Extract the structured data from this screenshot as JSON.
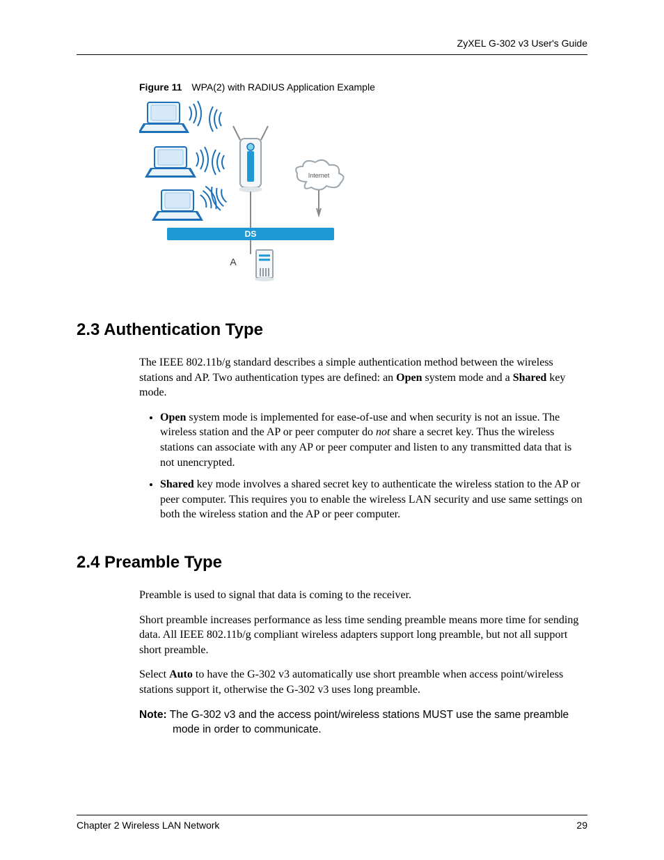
{
  "running_head": "ZyXEL G-302 v3 User's Guide",
  "figure": {
    "label": "Figure 11",
    "title": "WPA(2) with RADIUS Application Example",
    "labels": {
      "internet": "Internet",
      "ds": "DS",
      "a": "A"
    }
  },
  "section_23": {
    "heading": "2.3  Authentication Type",
    "intro_parts": {
      "p1": "The IEEE 802.11b/g standard describes a simple authentication method between the wireless stations and AP. Two authentication types are defined: an ",
      "open_bold": "Open",
      "p2": " system mode and a ",
      "shared_bold": "Shared",
      "p3": " key mode."
    },
    "bullet_open": {
      "bold": "Open",
      "t1": " system mode is implemented for ease-of-use and when security is not an issue. The wireless station and the AP or peer computer do ",
      "not_italic": "not",
      "t2": " share a secret key. Thus the wireless stations can associate with any AP or peer computer and listen to any transmitted data that is not unencrypted."
    },
    "bullet_shared": {
      "bold": "Shared",
      "t1": " key mode involves a shared secret key to authenticate the wireless station to the AP or peer computer. This requires you to enable the wireless LAN security and use same settings on both the wireless station and the AP or peer computer."
    }
  },
  "section_24": {
    "heading": "2.4  Preamble Type",
    "p1": "Preamble is used to signal that data is coming to the receiver.",
    "p2": "Short preamble increases performance as less time sending preamble means more time for sending data. All IEEE 802.11b/g compliant wireless adapters support long preamble, but not all support short preamble.",
    "p3a": "Select ",
    "p3_auto_bold": "Auto",
    "p3b": " to have the G-302 v3 automatically use short preamble when access point/wireless stations support it, otherwise the G-302 v3 uses long preamble.",
    "note_label": "Note:",
    "note_text": " The G-302 v3 and the access point/wireless stations MUST use the same preamble mode in order to communicate."
  },
  "footer": {
    "left": "Chapter 2 Wireless LAN Network",
    "right": "29"
  }
}
